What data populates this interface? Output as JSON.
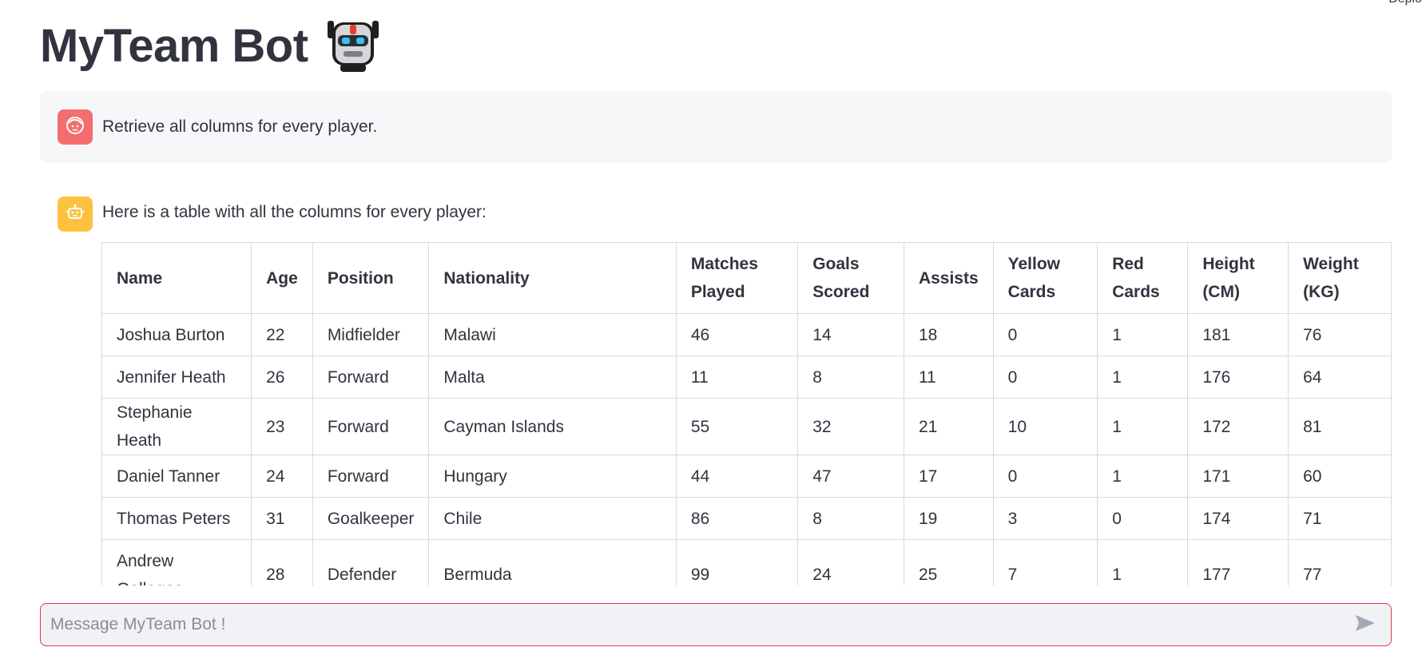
{
  "app": {
    "title": "MyTeam Bot",
    "deploy_label": "Deplo"
  },
  "messages": {
    "user": {
      "text": "Retrieve all columns for every player.",
      "avatar_icon": "user-face-icon"
    },
    "bot": {
      "text": "Here is a table with all the columns for every player:",
      "avatar_icon": "bot-icon"
    }
  },
  "table": {
    "headers": [
      "Name",
      "Age",
      "Position",
      "Nationality",
      "Matches Played",
      "Goals Scored",
      "Assists",
      "Yellow Cards",
      "Red Cards",
      "Height (CM)",
      "Weight (KG)"
    ],
    "rows": [
      [
        "Joshua Burton",
        "22",
        "Midfielder",
        "Malawi",
        "46",
        "14",
        "18",
        "0",
        "1",
        "181",
        "76"
      ],
      [
        "Jennifer Heath",
        "26",
        "Forward",
        "Malta",
        "11",
        "8",
        "11",
        "0",
        "1",
        "176",
        "64"
      ],
      [
        "Stephanie Heath",
        "23",
        "Forward",
        "Cayman Islands",
        "55",
        "32",
        "21",
        "10",
        "1",
        "172",
        "81"
      ],
      [
        "Daniel Tanner",
        "24",
        "Forward",
        "Hungary",
        "44",
        "47",
        "17",
        "0",
        "1",
        "171",
        "60"
      ],
      [
        "Thomas Peters",
        "31",
        "Goalkeeper",
        "Chile",
        "86",
        "8",
        "19",
        "3",
        "0",
        "174",
        "71"
      ],
      [
        "Andrew Gallegos",
        "28",
        "Defender",
        "Bermuda",
        "99",
        "24",
        "25",
        "7",
        "1",
        "177",
        "77"
      ]
    ]
  },
  "input": {
    "placeholder": "Message MyTeam Bot !",
    "value": "",
    "send_icon": "send-icon"
  },
  "colors": {
    "text": "#31333f",
    "user_avatar": "#f36e6e",
    "bot_avatar": "#fcc23f",
    "input_border": "#e2374a",
    "input_bg": "#f0f2f6",
    "user_msg_bg": "#f6f7f9"
  }
}
